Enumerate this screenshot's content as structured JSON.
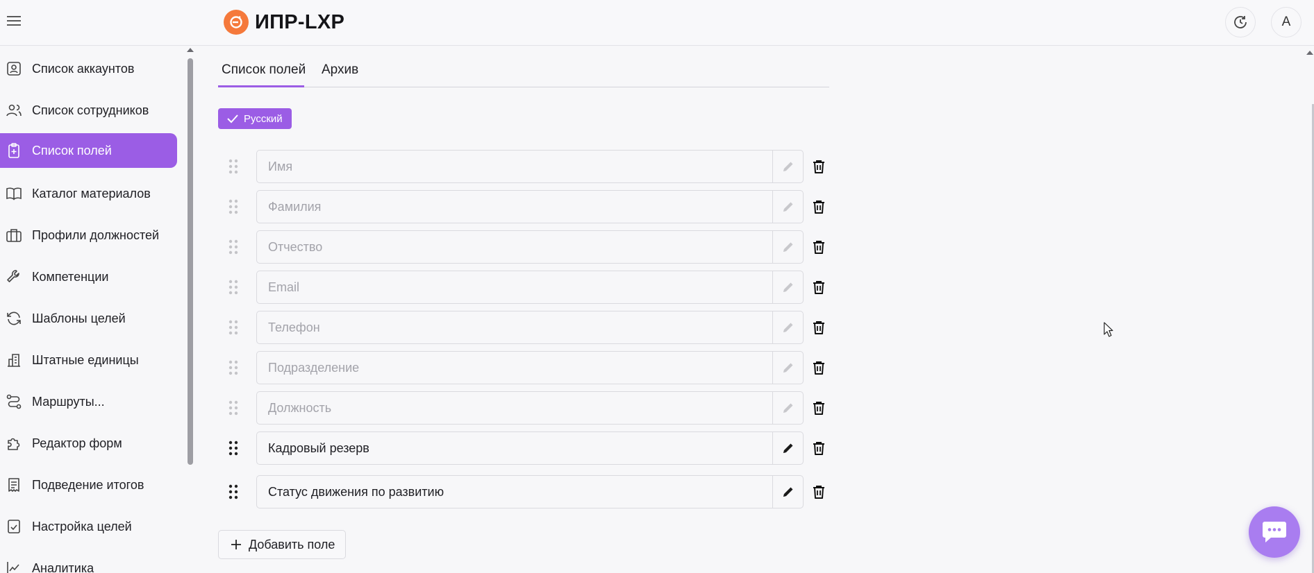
{
  "app": {
    "logo_text": "ИПР-LXP",
    "avatar_letter": "A"
  },
  "colors": {
    "accent": "#9b5de5",
    "logo": "#f5793b",
    "chat": "#a97df0"
  },
  "sidebar": {
    "items": [
      {
        "label": "Список аккаунтов",
        "icon": "user-card-icon",
        "active": false
      },
      {
        "label": "Список сотрудников",
        "icon": "users-icon",
        "active": false
      },
      {
        "label": "Список полей",
        "icon": "clipboard-plus-icon",
        "active": true
      },
      {
        "label": "Каталог материалов",
        "icon": "book-icon",
        "active": false
      },
      {
        "label": "Профили должностей",
        "icon": "briefcase-icon",
        "active": false
      },
      {
        "label": "Компетенции",
        "icon": "wrench-icon",
        "active": false
      },
      {
        "label": "Шаблоны целей",
        "icon": "refresh-icon",
        "active": false
      },
      {
        "label": "Штатные единицы",
        "icon": "building-icon",
        "active": false
      },
      {
        "label": "Маршруты...",
        "icon": "route-icon",
        "active": false
      },
      {
        "label": "Редактор форм",
        "icon": "puzzle-icon",
        "active": false
      },
      {
        "label": "Подведение итогов",
        "icon": "document-lines-icon",
        "active": false
      },
      {
        "label": "Настройка целей",
        "icon": "clipboard-check-icon",
        "active": false
      },
      {
        "label": "Аналитика",
        "icon": "chart-line-icon",
        "active": false
      }
    ]
  },
  "tabs": [
    {
      "label": "Список полей",
      "active": true
    },
    {
      "label": "Архив",
      "active": false
    }
  ],
  "language_chip": {
    "label": "Русский"
  },
  "fields": [
    {
      "value": "Имя",
      "editable": false
    },
    {
      "value": "Фамилия",
      "editable": false
    },
    {
      "value": "Отчество",
      "editable": false
    },
    {
      "value": "Email",
      "editable": false
    },
    {
      "value": "Телефон",
      "editable": false
    },
    {
      "value": "Подразделение",
      "editable": false
    },
    {
      "value": "Должность",
      "editable": false
    },
    {
      "value": "Кадровый резерв",
      "editable": true
    },
    {
      "value": "Статус движения по развитию",
      "editable": true
    }
  ],
  "add_field": {
    "label": "Добавить поле"
  }
}
